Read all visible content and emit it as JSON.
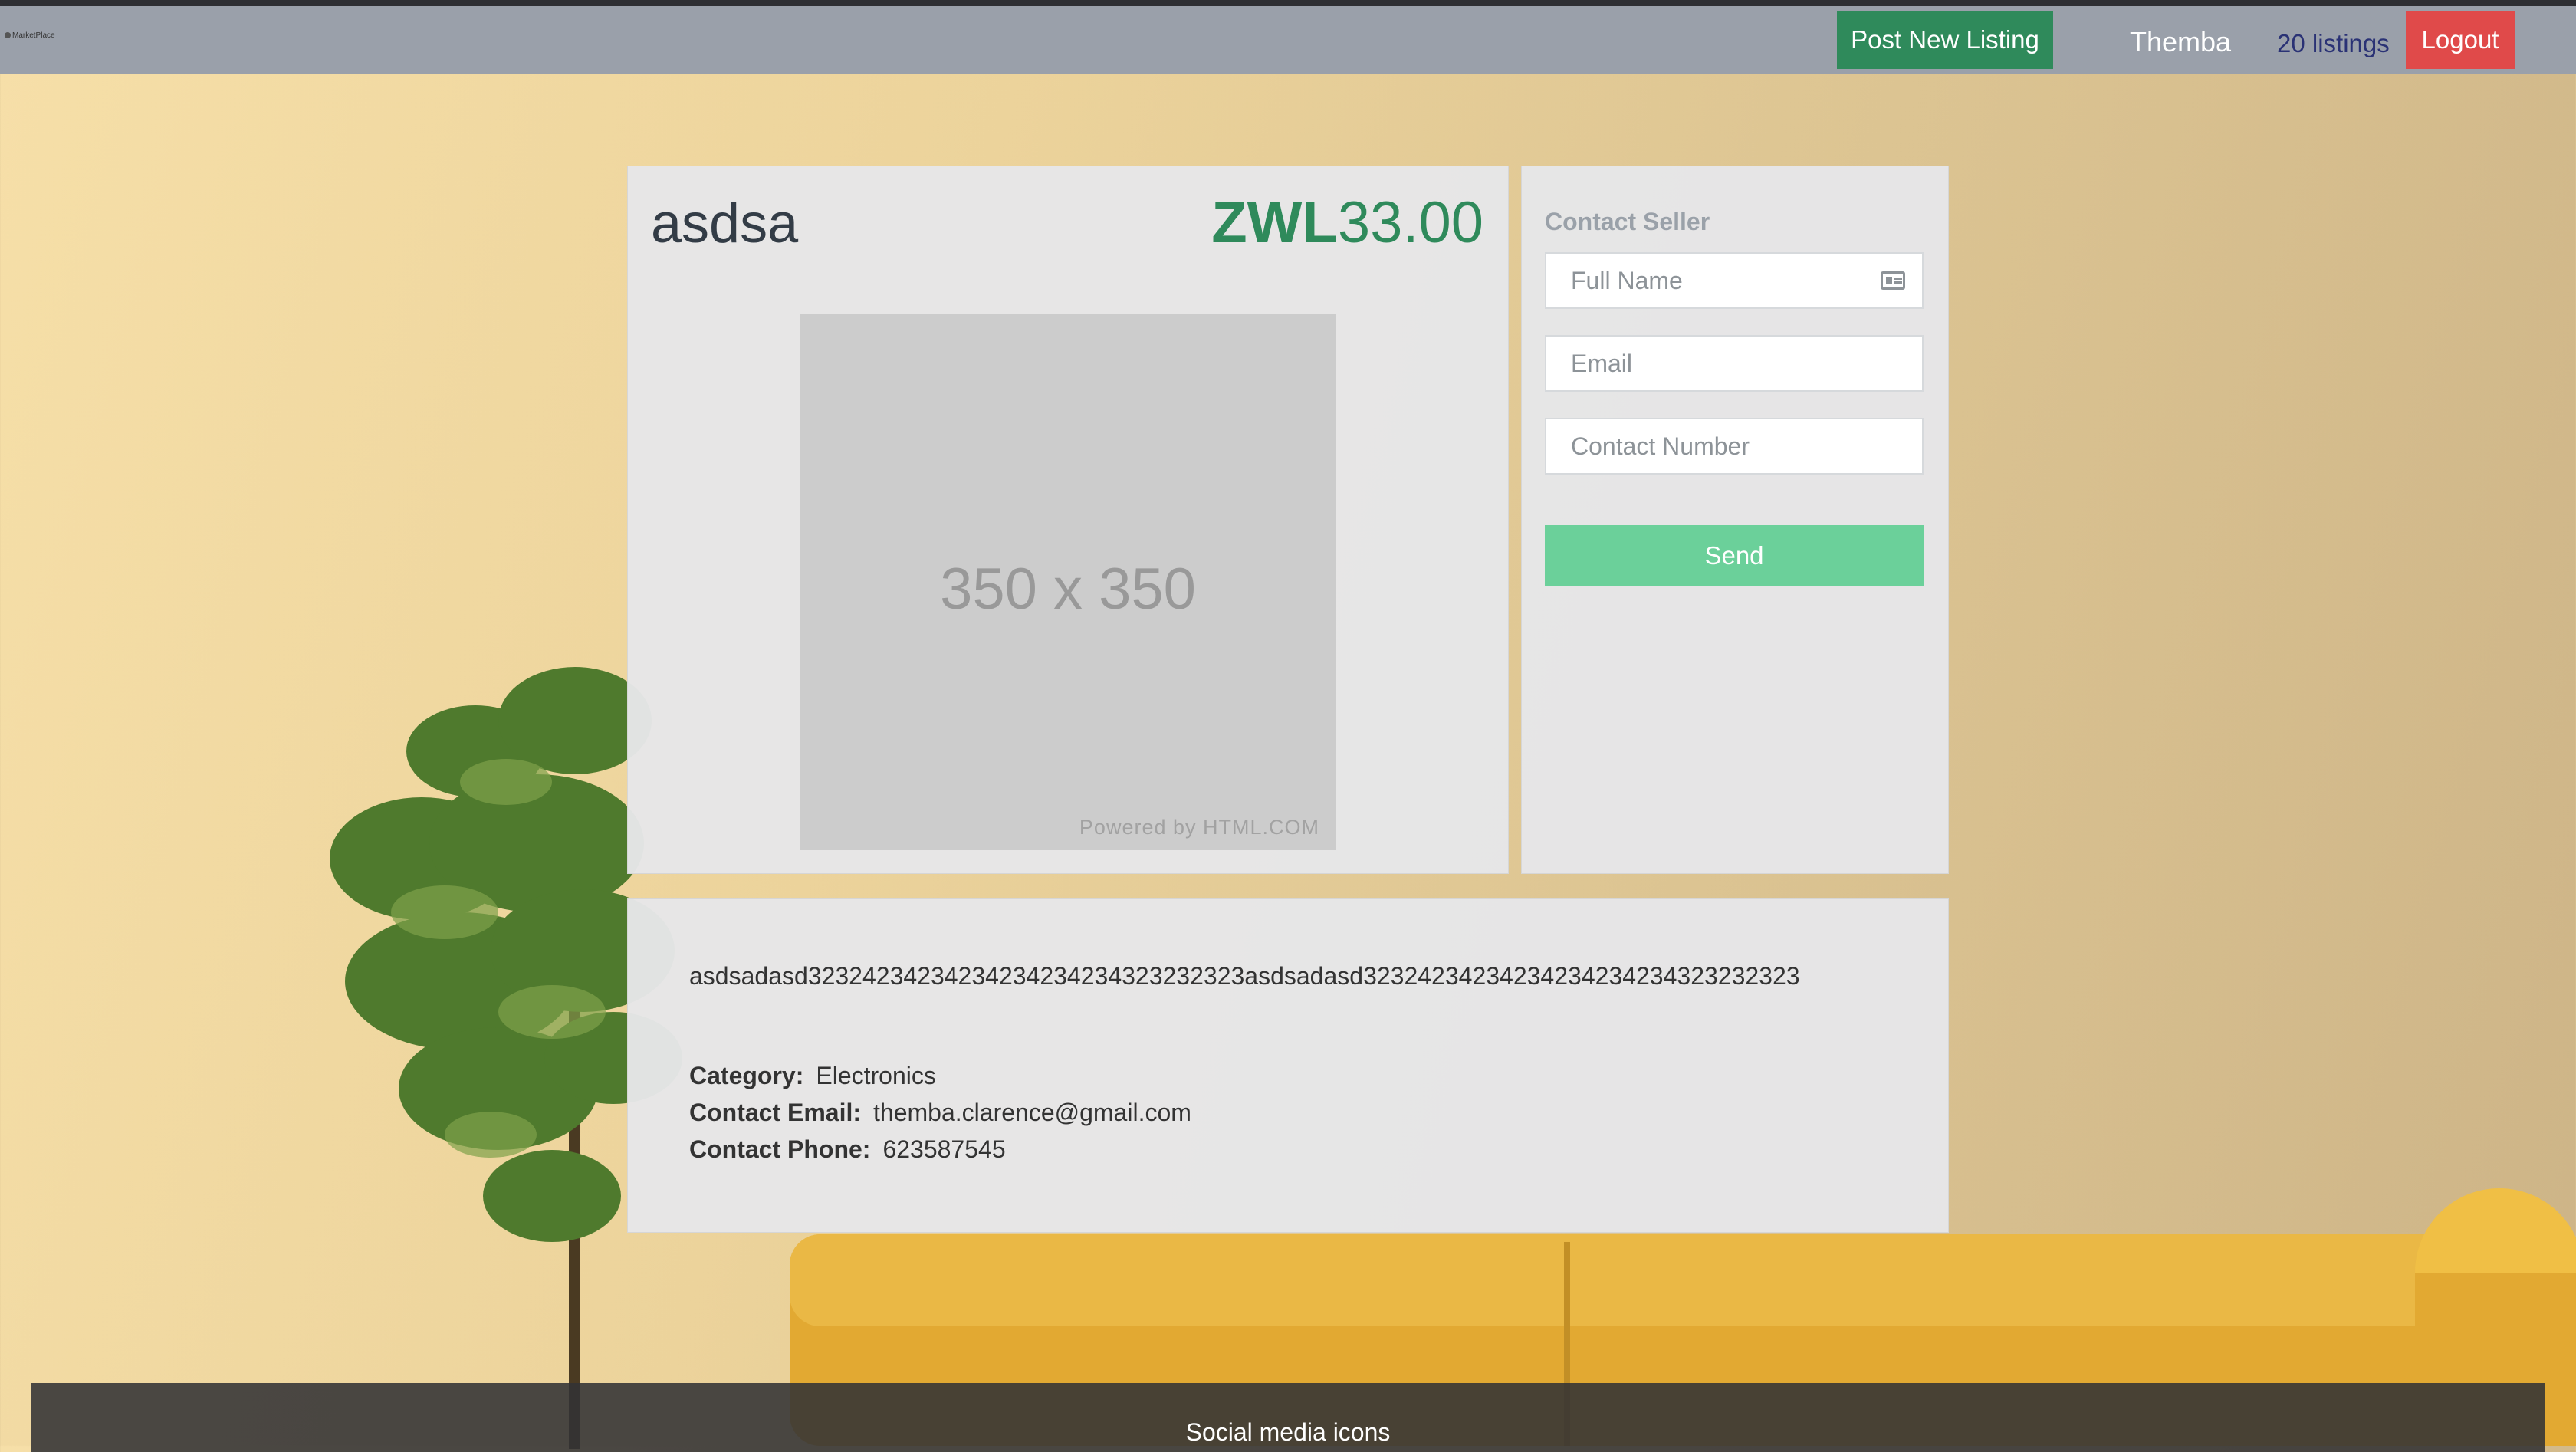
{
  "navbar": {
    "brand": "MarketPlace",
    "post_label": "Post New Listing",
    "username": "Themba",
    "listings_label": "20 listings",
    "logout_label": "Logout"
  },
  "listing": {
    "title": "asdsa",
    "currency": "ZWL",
    "amount": "33.00",
    "image_placeholder": "350 x 350",
    "image_powered": "Powered by HTML.COM"
  },
  "contact": {
    "heading": "Contact Seller",
    "name_placeholder": "Full Name",
    "email_placeholder": "Email",
    "phone_placeholder": "Contact Number",
    "send_label": "Send"
  },
  "details": {
    "description": "asdsadasd32324234234234234234234323232323asdsadasd32324234234234234234234323232323",
    "category_label": "Category:",
    "category_value": "Electronics",
    "email_label": "Contact Email:",
    "email_value": "themba.clarence@gmail.com",
    "phone_label": "Contact Phone:",
    "phone_value": "623587545"
  },
  "footer": {
    "text": "Social media icons"
  },
  "colors": {
    "primary_green": "#2f8a5b",
    "send_green": "#6bd09a",
    "logout_red": "#e04a4a",
    "navbar_gray": "#9aa0aa"
  }
}
